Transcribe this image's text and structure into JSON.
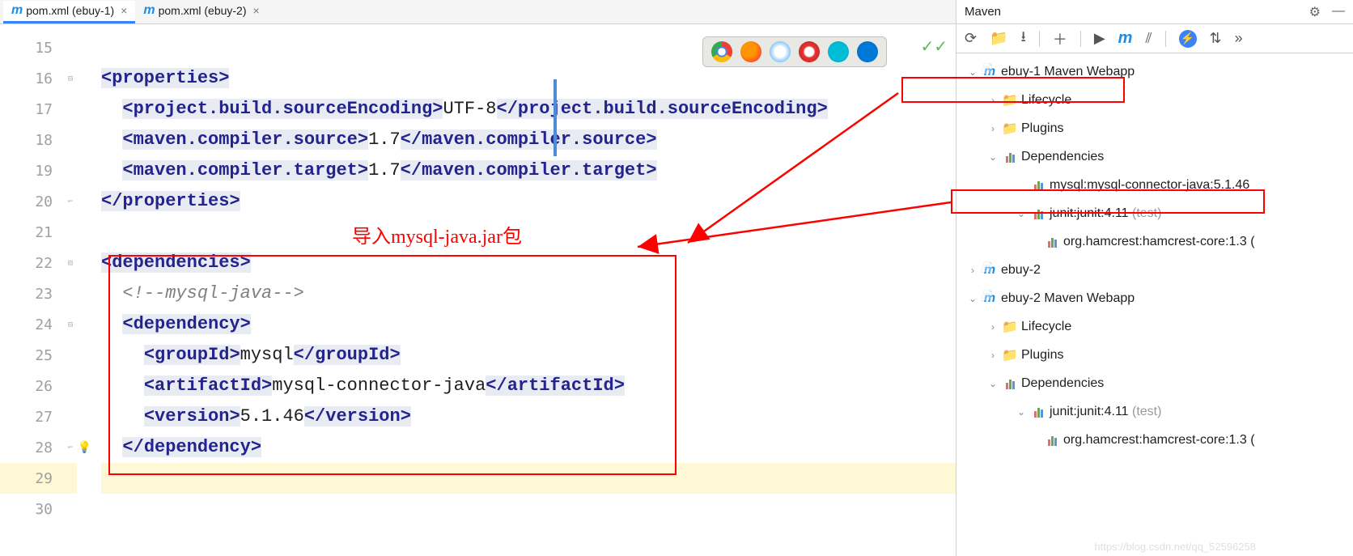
{
  "tabs": [
    {
      "label": "pom.xml (ebuy-1)",
      "active": true
    },
    {
      "label": "pom.xml (ebuy-2)",
      "active": false
    }
  ],
  "gutter": [
    "15",
    "16",
    "17",
    "18",
    "19",
    "20",
    "21",
    "22",
    "23",
    "24",
    "25",
    "26",
    "27",
    "28",
    "29",
    "30"
  ],
  "code": {
    "l1": "",
    "l2_open": "<",
    "l2_tag": "properties",
    "l2_close": ">",
    "l3_open": "<",
    "l3_tag": "project.build.sourceEncoding",
    "l3_close": ">",
    "l3_val": "UTF-8",
    "l3_open2": "</",
    "l3_tag2": "project.build.sourceEncoding",
    "l3_close2": ">",
    "l4_open": "<",
    "l4_tag": "maven.compiler.source",
    "l4_close": ">",
    "l4_val": "1.7",
    "l4_open2": "</",
    "l4_tag2": "maven.compiler.source",
    "l4_close2": ">",
    "l5_open": "<",
    "l5_tag": "maven.compiler.target",
    "l5_close": ">",
    "l5_val": "1.7",
    "l5_open2": "</",
    "l5_tag2": "maven.compiler.target",
    "l5_close2": ">",
    "l6_open": "</",
    "l6_tag": "properties",
    "l6_close": ">",
    "l8_open": "<",
    "l8_tag": "dependencies",
    "l8_close": ">",
    "l9_comment": "<!--mysql-java-->",
    "l10_open": "<",
    "l10_tag": "dependency",
    "l10_close": ">",
    "l11_open": "<",
    "l11_tag": "groupId",
    "l11_close": ">",
    "l11_val": "mysql",
    "l11_open2": "</",
    "l11_tag2": "groupId",
    "l11_close2": ">",
    "l12_open": "<",
    "l12_tag": "artifactId",
    "l12_close": ">",
    "l12_val": "mysql-connector-java",
    "l12_open2": "</",
    "l12_tag2": "artifactId",
    "l12_close2": ">",
    "l13_open": "<",
    "l13_tag": "version",
    "l13_close": ">",
    "l13_val": "5.1.46",
    "l13_open2": "</",
    "l13_tag2": "version",
    "l13_close2": ">",
    "l14_open": "</",
    "l14_tag": "dependency",
    "l14_close": ">"
  },
  "annotation": "导入mysql-java.jar包",
  "maven": {
    "title": "Maven",
    "nodes": {
      "ebuy1": "ebuy-1 Maven Webapp",
      "lifecycle": "Lifecycle",
      "plugins": "Plugins",
      "deps": "Dependencies",
      "mysql": "mysql:mysql-connector-java:5.1.46",
      "junit": "junit:junit:4.11",
      "junit_scope": " (test)",
      "hamcrest": "org.hamcrest:hamcrest-core:1.3 (",
      "ebuy2": "ebuy-2",
      "ebuy2web": "ebuy-2 Maven Webapp"
    }
  },
  "watermark": "https://blog.csdn.net/qq_52596258"
}
